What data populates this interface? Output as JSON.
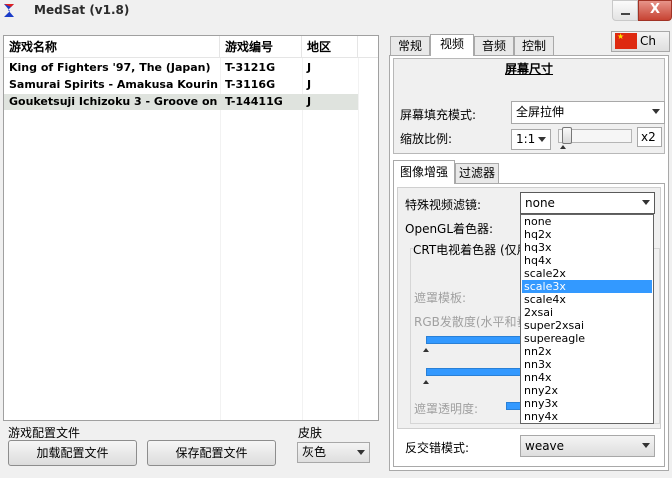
{
  "window": {
    "title": "MedSat (v1.8)",
    "close_label": "X"
  },
  "game_list": {
    "columns": [
      "游戏名称",
      "游戏编号",
      "地区"
    ],
    "rows": [
      {
        "name": "King of Fighters '97, The (Japan)",
        "id": "T-3121G",
        "region": "J"
      },
      {
        "name": "Samurai Spirits - Amakusa Kourin ...",
        "id": "T-3116G",
        "region": "J"
      },
      {
        "name": "Gouketsuji Ichizoku 3 - Groove on ...",
        "id": "T-14411G",
        "region": "J"
      }
    ]
  },
  "config": {
    "group_label": "游戏配置文件",
    "load_button": "加载配置文件",
    "save_button": "保存配置文件"
  },
  "skin": {
    "label": "皮肤",
    "value": "灰色"
  },
  "language": {
    "value": "Ch"
  },
  "main_tabs": [
    "常规",
    "视频",
    "音频",
    "控制"
  ],
  "screen_size": {
    "title": "屏幕尺寸",
    "fill_mode_label": "屏幕填充模式:",
    "fill_mode_value": "全屏拉伸",
    "scale_label": "缩放比例:",
    "scale_ratio_value": "1:1",
    "scale_multiplier": "x2"
  },
  "sub_tabs": [
    "图像增强",
    "过滤器"
  ],
  "enhance": {
    "filter_label": "特殊视频滤镜:",
    "filter_value": "none",
    "shader_label": "OpenGL着色器:",
    "crt_label": "CRT电视着色器 (仅用",
    "mask_label": "遮罩模板:",
    "rgb_label": "RGB发散度(水平和垂",
    "mask_opacity_label": "遮罩透明度:",
    "deinterlace_label": "反交错模式:",
    "deinterlace_value": "weave"
  },
  "filter_options": [
    "none",
    "hq2x",
    "hq3x",
    "hq4x",
    "scale2x",
    "scale3x",
    "scale4x",
    "2xsai",
    "super2xsai",
    "supereagle",
    "nn2x",
    "nn3x",
    "nn4x",
    "nny2x",
    "nny3x",
    "nny4x"
  ],
  "filter_highlighted": "scale3x",
  "colors": {
    "highlight": "#3399ff",
    "close_button": "#c74333"
  }
}
